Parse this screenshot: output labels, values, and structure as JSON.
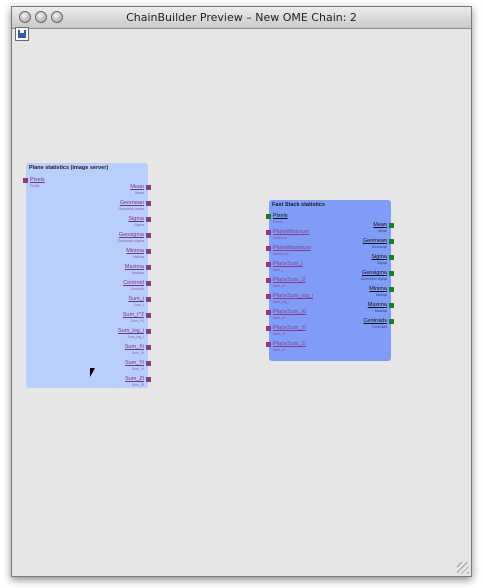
{
  "window": {
    "title": "ChainBuilder Preview – New OME Chain: 2"
  },
  "toolbar": {
    "save_icon": "floppy-disk"
  },
  "plane_node": {
    "title": "Plane statistics (image server)",
    "inputs": [
      {
        "label": "Pixels",
        "sub": "Pixels"
      }
    ],
    "outputs": [
      {
        "label": "Mean",
        "sub": "Mean"
      },
      {
        "label": "Geomean",
        "sub": "Geometric mean"
      },
      {
        "label": "Sigma",
        "sub": "Sigma"
      },
      {
        "label": "Geosigma",
        "sub": "Geometric sigma"
      },
      {
        "label": "Minima",
        "sub": "Minima"
      },
      {
        "label": "Maxima",
        "sub": "Maxima"
      },
      {
        "label": "Centroid",
        "sub": "Centroid"
      },
      {
        "label": "Sum_i",
        "sub": "Sum_i"
      },
      {
        "label": "Sum_i^2",
        "sub": "Sum_i^2"
      },
      {
        "label": "Sum_log_i",
        "sub": "Sum_log_i"
      },
      {
        "label": "Sum_Xi",
        "sub": "Sum_Xi"
      },
      {
        "label": "Sum_Yi",
        "sub": "Sum_Yi"
      },
      {
        "label": "Sum_Zi",
        "sub": "Sum_Zi"
      }
    ]
  },
  "fast_node": {
    "title": "Fast Stack statistics",
    "inputs": [
      {
        "label": "Pixels",
        "sub": "Pixels"
      },
      {
        "label": "PlaneMinimum",
        "sub": "Minimum"
      },
      {
        "label": "PlaneMaximum",
        "sub": "Maximum"
      },
      {
        "label": "PlaneSum_i",
        "sub": "Sum_i"
      },
      {
        "label": "PlaneSum_i2",
        "sub": "Sum_i2"
      },
      {
        "label": "PlaneSum_log_i",
        "sub": "Sum_log_i"
      },
      {
        "label": "PlaneSum_Xi",
        "sub": "Sum_Xi"
      },
      {
        "label": "PlaneSum_Yi",
        "sub": "Sum_Yi"
      },
      {
        "label": "PlaneSum_Zi",
        "sub": "Sum_Zi"
      }
    ],
    "outputs": [
      {
        "label": "Mean",
        "sub": "Mean"
      },
      {
        "label": "Geomean",
        "sub": "Geomean"
      },
      {
        "label": "Sigma",
        "sub": "Sigma"
      },
      {
        "label": "Geosigma",
        "sub": "Geometric sigma"
      },
      {
        "label": "Minima",
        "sub": "Minima"
      },
      {
        "label": "Maxima",
        "sub": "Maxima"
      },
      {
        "label": "Centroids",
        "sub": "Centroids"
      }
    ]
  }
}
